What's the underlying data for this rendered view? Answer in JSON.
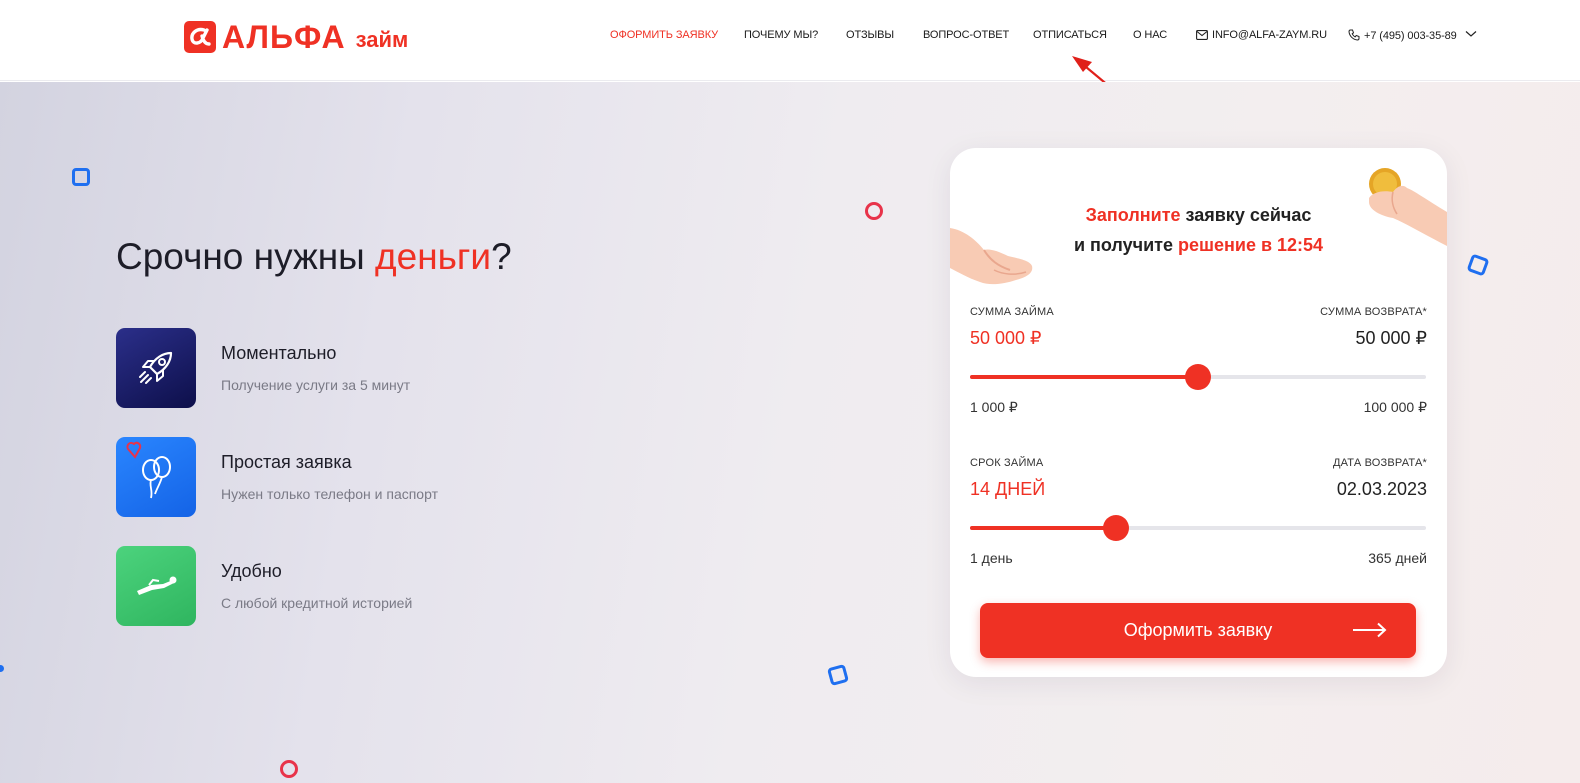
{
  "brand": {
    "name": "АЛЬФА",
    "suffix": "займ",
    "color": "#ef3124"
  },
  "nav": {
    "items": [
      {
        "label": "ОФОРМИТЬ ЗАЯВКУ",
        "active": true
      },
      {
        "label": "ПОЧЕМУ МЫ?"
      },
      {
        "label": "ОТЗЫВЫ"
      },
      {
        "label": "ВОПРОС-ОТВЕТ"
      },
      {
        "label": "ОТПИСАТЬСЯ"
      },
      {
        "label": "О НАС"
      }
    ],
    "email": "INFO@ALFA-ZAYM.RU",
    "phone": "+7 (495) 003-35-89",
    "email_icon": "mail-icon",
    "phone_icon": "phone-icon",
    "dropdown_icon": "chevron-down-icon"
  },
  "hero": {
    "title_prefix": "Срочно нужны ",
    "title_highlight": "деньги",
    "title_suffix": "?",
    "features": [
      {
        "title": "Моментально",
        "desc": "Получение услуги за 5 минут",
        "icon": "rocket-icon",
        "color": "#1c1f6e"
      },
      {
        "title": "Простая заявка",
        "desc": "Нужен только телефон и паспорт",
        "icon": "balloons-icon",
        "color": "#1f75f5"
      },
      {
        "title": "Удобно",
        "desc": "С любой кредитной историей",
        "icon": "flying-person-icon",
        "color": "#3ac46c"
      }
    ]
  },
  "calculator": {
    "heading_red_1": "Заполните",
    "heading_dark_1": " заявку сейчас",
    "heading_dark_2": "и получите ",
    "heading_red_2": "решение в 12:54",
    "amount": {
      "label": "СУММА ЗАЙМА",
      "value": "50 000 ₽",
      "return_label": "СУММА ВОЗВРАТА*",
      "return_value": "50 000 ₽",
      "min": "1 000 ₽",
      "max": "100 000 ₽",
      "fraction": 0.5
    },
    "term": {
      "label": "СРОК ЗАЙМА",
      "value": "14 ДНЕЙ",
      "return_label": "ДАТА ВОЗВРАТА*",
      "return_value": "02.03.2023",
      "min": "1 день",
      "max": "365 дней",
      "fraction": 0.32
    },
    "submit_label": "Оформить заявку"
  }
}
